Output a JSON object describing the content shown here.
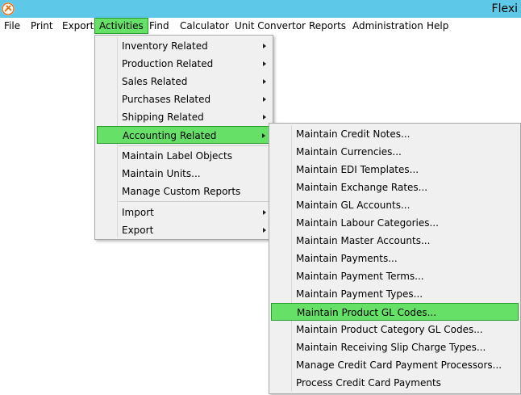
{
  "window": {
    "title": "Flexi"
  },
  "icons": {
    "app": "app-logo-icon",
    "submenu": "chevron-right-icon"
  },
  "colors": {
    "titlebar": "#5ec8e8",
    "highlight": "#66e066",
    "highlight_border": "#2a9a2a",
    "menu_bg": "#f0f0f0"
  },
  "menubar": {
    "items": [
      "File",
      "Print",
      "Export",
      "Activities",
      "Find",
      "Calculator",
      "Unit Convertor",
      "Reports",
      "Administration",
      "Help"
    ],
    "active": "Activities"
  },
  "activities_menu": {
    "items": [
      {
        "label": "Inventory Related",
        "submenu": true
      },
      {
        "label": "Production Related",
        "submenu": true
      },
      {
        "label": "Sales Related",
        "submenu": true
      },
      {
        "label": "Purchases Related",
        "submenu": true
      },
      {
        "label": "Shipping Related",
        "submenu": true
      },
      {
        "label": "Accounting Related",
        "submenu": true,
        "highlighted": true
      },
      {
        "label": "Maintain Label Objects"
      },
      {
        "label": "Maintain Units..."
      },
      {
        "label": "Manage Custom Reports"
      },
      {
        "label": "Import",
        "submenu": true
      },
      {
        "label": "Export",
        "submenu": true
      }
    ]
  },
  "accounting_menu": {
    "items": [
      {
        "label": "Maintain Credit Notes..."
      },
      {
        "label": "Maintain Currencies..."
      },
      {
        "label": "Maintain EDI Templates..."
      },
      {
        "label": "Maintain Exchange Rates..."
      },
      {
        "label": "Maintain GL Accounts..."
      },
      {
        "label": "Maintain Labour Categories..."
      },
      {
        "label": "Maintain Master Accounts..."
      },
      {
        "label": "Maintain Payments..."
      },
      {
        "label": "Maintain Payment Terms..."
      },
      {
        "label": "Maintain Payment Types..."
      },
      {
        "label": "Maintain Product GL Codes...",
        "highlighted": true
      },
      {
        "label": "Maintain Product Category GL Codes..."
      },
      {
        "label": "Maintain Receiving Slip Charge Types..."
      },
      {
        "label": "Manage Credit Card Payment Processors..."
      },
      {
        "label": "Process Credit Card Payments"
      }
    ]
  }
}
